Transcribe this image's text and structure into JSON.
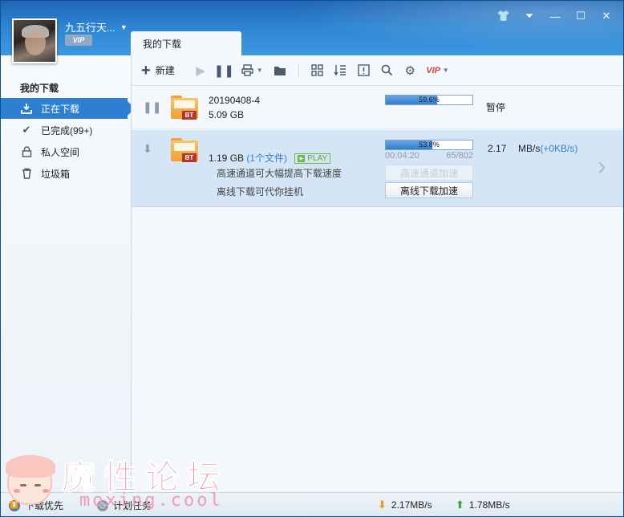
{
  "user": {
    "name": "九五行天...",
    "badge": "VIP"
  },
  "tab": {
    "label": "我的下载"
  },
  "sidebar": {
    "heading": "我的下载",
    "items": [
      {
        "label": "正在下载",
        "icon": "download-tray-icon",
        "active": true
      },
      {
        "label": "已完成(99+)",
        "icon": "checkmark-icon",
        "active": false
      },
      {
        "label": "私人空间",
        "icon": "lock-icon",
        "active": false
      },
      {
        "label": "垃圾箱",
        "icon": "trash-icon",
        "active": false
      }
    ]
  },
  "toolbar": {
    "new_label": "新建",
    "icons": [
      "play-icon",
      "pause-icon",
      "printer-icon",
      "folder-icon",
      "grid-icon",
      "sort-icon",
      "info-icon",
      "search-icon",
      "gear-icon",
      "vip-icon"
    ]
  },
  "tasks": [
    {
      "name": "20190408-4",
      "size": "5.09 GB",
      "progress": 0.596,
      "progress_text": "59.6%",
      "status": "暂停"
    },
    {
      "size": "1.19 GB",
      "files": "(1个文件)",
      "play": "PLAY",
      "line1": "高速通道可大幅提高下载速度",
      "line2": "离线下载可代你挂机",
      "progress": 0.538,
      "progress_text": "53.8%",
      "elapsed": "00:04:20",
      "pieces": "65/802",
      "speed": "2.17",
      "speed_unit": "MB/s",
      "speed_delta": "(+0KB/s)",
      "btn_highspeed": "高速通道加速",
      "btn_offline": "离线下载加速"
    }
  ],
  "statusbar": {
    "priority": "下载优先",
    "schedule": "计划任务",
    "down_speed": "2.17MB/s",
    "up_speed": "1.78MB/s"
  },
  "watermark": {
    "title": "魔性论坛",
    "url": "moxing.cool"
  },
  "colors": {
    "accent": "#2f7fd0",
    "title_bar": "#2e86d4",
    "vip_red": "#d0463c",
    "play_green": "#5aa636"
  }
}
